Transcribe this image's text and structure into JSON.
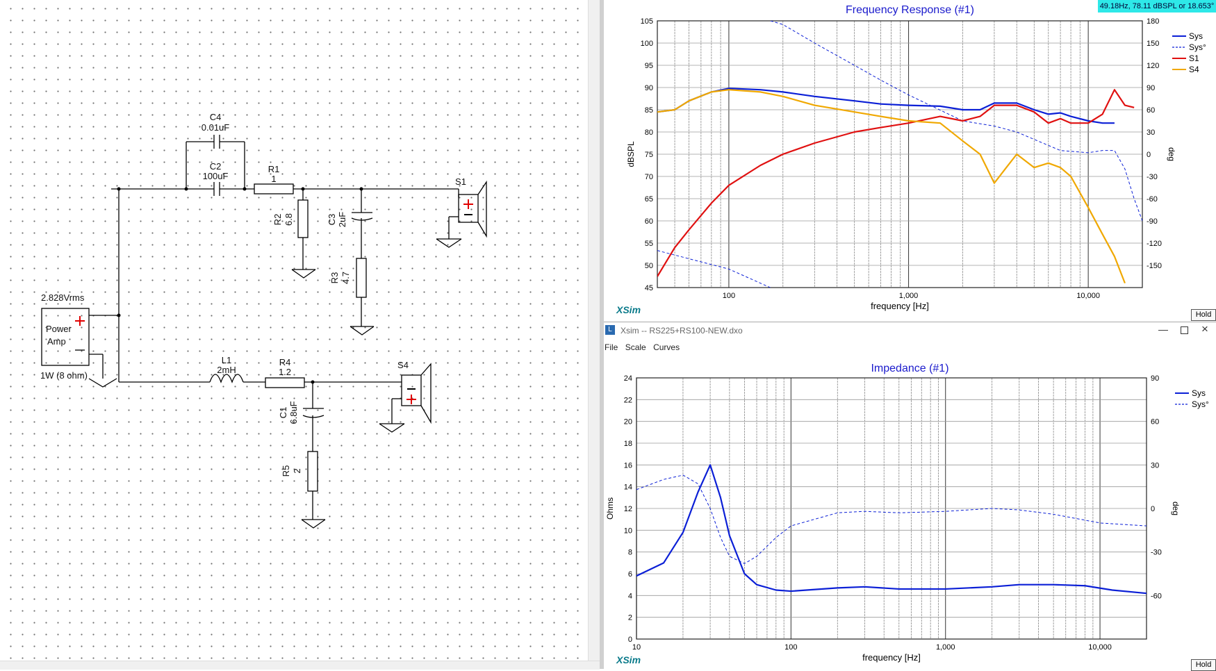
{
  "schematic": {
    "components": {
      "c4": {
        "name": "C4",
        "value": "0.01uF"
      },
      "c2": {
        "name": "C2",
        "value": "100uF"
      },
      "r1": {
        "name": "R1",
        "value": "1"
      },
      "r2": {
        "name": "R2",
        "value": "6.8"
      },
      "c3": {
        "name": "C3",
        "value": "2uF"
      },
      "r3": {
        "name": "R3",
        "value": "4.7"
      },
      "s1": {
        "name": "S1"
      },
      "l1": {
        "name": "L1",
        "value": "2mH"
      },
      "r4": {
        "name": "R4",
        "value": "1.2"
      },
      "c1": {
        "name": "C1",
        "value": "6.8uF"
      },
      "r5": {
        "name": "R5",
        "value": "2"
      },
      "s4": {
        "name": "S4"
      }
    },
    "amp": {
      "voltage": "2.828Vrms",
      "label1": "Power",
      "label2": "Amp",
      "power": "1W (8 ohm)"
    }
  },
  "freq_panel": {
    "title": "Frequency Response (#1)",
    "readout": "49.18Hz, 78.11 dBSPL or 18.653°",
    "brand": "XSim",
    "hold": "Hold",
    "xlabel": "frequency [Hz]",
    "ylabel": "dBSPL",
    "y2label": "deg",
    "yticks": [
      "105",
      "100",
      "95",
      "90",
      "85",
      "80",
      "75",
      "70",
      "65",
      "60",
      "55",
      "50",
      "45"
    ],
    "y2ticks": [
      "180",
      "150",
      "120",
      "90",
      "60",
      "30",
      "0",
      "-30",
      "-60",
      "-90",
      "-120",
      "-150"
    ],
    "xticks": [
      "100",
      "1,000",
      "10,000"
    ],
    "legend": [
      {
        "label": "Sys",
        "color": "#0b1fd6",
        "dash": false
      },
      {
        "label": "Sys°",
        "color": "#0b1fd6",
        "dash": true
      },
      {
        "label": "S1",
        "color": "#e01010",
        "dash": false
      },
      {
        "label": "S4",
        "color": "#f0a800",
        "dash": false
      }
    ]
  },
  "window": {
    "title": "Xsim -- RS225+RS100-NEW.dxo",
    "menu": [
      "File",
      "Scale",
      "Curves"
    ]
  },
  "imp_panel": {
    "title": "Impedance (#1)",
    "brand": "XSim",
    "hold": "Hold",
    "xlabel": "frequency [Hz]",
    "ylabel": "Ohms",
    "y2label": "deg",
    "yticks": [
      "24",
      "22",
      "20",
      "18",
      "16",
      "14",
      "12",
      "10",
      "8",
      "6",
      "4",
      "2",
      "0"
    ],
    "y2ticks": [
      "90",
      "60",
      "30",
      "0",
      "-30",
      "-60"
    ],
    "xticks": [
      "10",
      "100",
      "1,000",
      "10,000"
    ],
    "legend": [
      {
        "label": "Sys",
        "color": "#0b1fd6",
        "dash": false
      },
      {
        "label": "Sys°",
        "color": "#0b1fd6",
        "dash": true
      }
    ]
  },
  "chart_data": [
    {
      "type": "line",
      "title": "Frequency Response (#1)",
      "xlabel": "frequency [Hz]",
      "ylabel": "dBSPL",
      "y2label": "deg",
      "xscale": "log",
      "xlim": [
        40,
        20000
      ],
      "ylim": [
        45,
        105
      ],
      "y2lim": [
        -180,
        180
      ],
      "grid": true,
      "legend_position": "top-right",
      "series": [
        {
          "name": "Sys",
          "axis": "left",
          "points": [
            [
              40,
              84.5
            ],
            [
              50,
              85
            ],
            [
              60,
              87
            ],
            [
              80,
              89
            ],
            [
              100,
              89.8
            ],
            [
              150,
              89.5
            ],
            [
              200,
              89
            ],
            [
              300,
              88
            ],
            [
              500,
              87
            ],
            [
              700,
              86.3
            ],
            [
              1000,
              86
            ],
            [
              1500,
              85.8
            ],
            [
              2000,
              85
            ],
            [
              2500,
              85
            ],
            [
              3000,
              86.5
            ],
            [
              4000,
              86.5
            ],
            [
              5000,
              85
            ],
            [
              6000,
              84
            ],
            [
              7000,
              84.3
            ],
            [
              8000,
              83.5
            ],
            [
              10000,
              82.5
            ],
            [
              12000,
              82
            ],
            [
              14000,
              82
            ]
          ]
        },
        {
          "name": "Sys°",
          "axis": "right",
          "points": [
            [
              40,
              -130
            ],
            [
              100,
              -155
            ],
            [
              170,
              -180
            ],
            [
              170.5,
              180
            ],
            [
              200,
              175
            ],
            [
              300,
              150
            ],
            [
              500,
              120
            ],
            [
              700,
              100
            ],
            [
              1000,
              80
            ],
            [
              2000,
              45
            ],
            [
              3000,
              38
            ],
            [
              4000,
              30
            ],
            [
              5000,
              20
            ],
            [
              7000,
              5
            ],
            [
              10000,
              2
            ],
            [
              12000,
              5
            ],
            [
              14000,
              5
            ],
            [
              16000,
              -20
            ],
            [
              18000,
              -60
            ],
            [
              20000,
              -90
            ]
          ]
        },
        {
          "name": "S1",
          "axis": "left",
          "points": [
            [
              40,
              47.5
            ],
            [
              50,
              54
            ],
            [
              60,
              58
            ],
            [
              80,
              64
            ],
            [
              100,
              68
            ],
            [
              150,
              72.5
            ],
            [
              200,
              75
            ],
            [
              300,
              77.5
            ],
            [
              500,
              80
            ],
            [
              700,
              81
            ],
            [
              1000,
              82
            ],
            [
              1500,
              83.5
            ],
            [
              2000,
              82.5
            ],
            [
              2500,
              83.5
            ],
            [
              3000,
              86
            ],
            [
              4000,
              86
            ],
            [
              5000,
              84.5
            ],
            [
              6000,
              82
            ],
            [
              7000,
              83
            ],
            [
              8000,
              82
            ],
            [
              10000,
              82
            ],
            [
              12000,
              84
            ],
            [
              14000,
              89.5
            ],
            [
              16000,
              86
            ],
            [
              18000,
              85.5
            ]
          ]
        },
        {
          "name": "S4",
          "axis": "left",
          "points": [
            [
              40,
              84.5
            ],
            [
              50,
              85
            ],
            [
              60,
              87
            ],
            [
              80,
              89
            ],
            [
              100,
              89.5
            ],
            [
              150,
              89
            ],
            [
              200,
              88
            ],
            [
              300,
              86
            ],
            [
              500,
              84.5
            ],
            [
              700,
              83.5
            ],
            [
              1000,
              82.5
            ],
            [
              1500,
              82
            ],
            [
              2000,
              78
            ],
            [
              2500,
              75
            ],
            [
              3000,
              68.5
            ],
            [
              3500,
              72
            ],
            [
              4000,
              75
            ],
            [
              5000,
              72
            ],
            [
              6000,
              73
            ],
            [
              7000,
              72
            ],
            [
              8000,
              70
            ],
            [
              10000,
              63
            ],
            [
              12000,
              57
            ],
            [
              14000,
              52
            ],
            [
              16000,
              46
            ]
          ]
        }
      ]
    },
    {
      "type": "line",
      "title": "Impedance (#1)",
      "xlabel": "frequency [Hz]",
      "ylabel": "Ohms",
      "y2label": "deg",
      "xscale": "log",
      "xlim": [
        10,
        20000
      ],
      "ylim": [
        0,
        24
      ],
      "y2lim": [
        -90,
        90
      ],
      "grid": true,
      "legend_position": "top-right",
      "series": [
        {
          "name": "Sys",
          "axis": "left",
          "points": [
            [
              10,
              5.8
            ],
            [
              15,
              7
            ],
            [
              20,
              9.8
            ],
            [
              25,
              13.5
            ],
            [
              30,
              16
            ],
            [
              35,
              13
            ],
            [
              40,
              9.5
            ],
            [
              50,
              6
            ],
            [
              60,
              5
            ],
            [
              80,
              4.5
            ],
            [
              100,
              4.4
            ],
            [
              200,
              4.7
            ],
            [
              300,
              4.8
            ],
            [
              500,
              4.6
            ],
            [
              1000,
              4.6
            ],
            [
              2000,
              4.8
            ],
            [
              3000,
              5
            ],
            [
              5000,
              5
            ],
            [
              8000,
              4.9
            ],
            [
              12000,
              4.5
            ],
            [
              20000,
              4.2
            ]
          ]
        },
        {
          "name": "Sys°",
          "axis": "right",
          "points": [
            [
              10,
              13
            ],
            [
              15,
              20
            ],
            [
              20,
              23
            ],
            [
              25,
              17
            ],
            [
              30,
              0
            ],
            [
              35,
              -20
            ],
            [
              40,
              -33
            ],
            [
              50,
              -38
            ],
            [
              60,
              -33
            ],
            [
              80,
              -20
            ],
            [
              100,
              -12
            ],
            [
              200,
              -3
            ],
            [
              300,
              -2
            ],
            [
              500,
              -3
            ],
            [
              1000,
              -2
            ],
            [
              2000,
              0
            ],
            [
              3000,
              -1
            ],
            [
              5000,
              -4
            ],
            [
              10000,
              -10
            ],
            [
              20000,
              -12
            ]
          ]
        }
      ]
    }
  ]
}
